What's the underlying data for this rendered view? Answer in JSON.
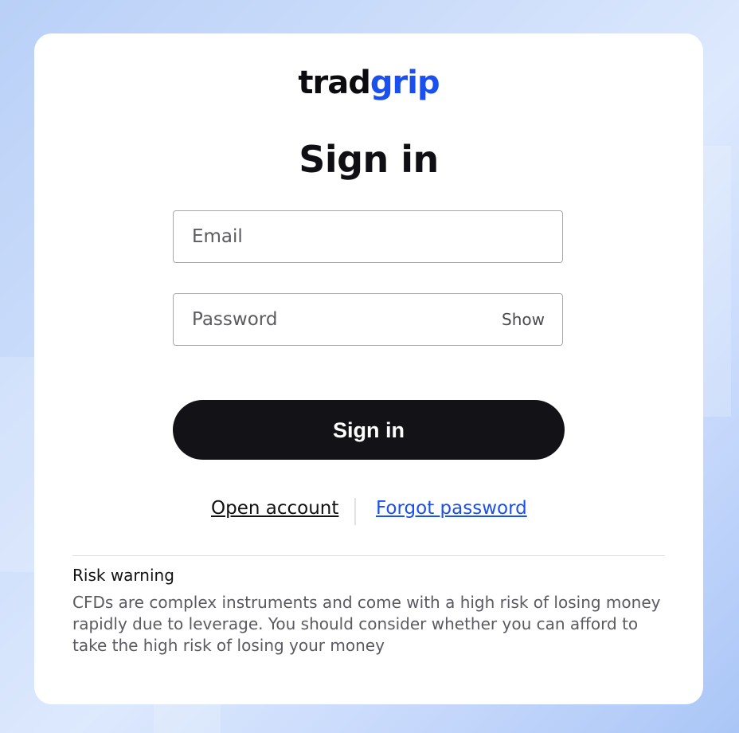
{
  "logo": {
    "part1": "trad",
    "part2": "grip",
    "accent_color": "#1a4ff0"
  },
  "title": "Sign in",
  "form": {
    "email": {
      "placeholder": "Email",
      "value": ""
    },
    "password": {
      "placeholder": "Password",
      "value": "",
      "toggle_label": "Show"
    },
    "submit_label": "Sign in"
  },
  "links": {
    "open_account": "Open account",
    "forgot_password": "Forgot password"
  },
  "risk": {
    "title": "Risk warning",
    "text": "CFDs are complex instruments and come with a high risk of losing money rapidly due to leverage. You should consider whether you can afford to take the high risk of losing your money"
  }
}
